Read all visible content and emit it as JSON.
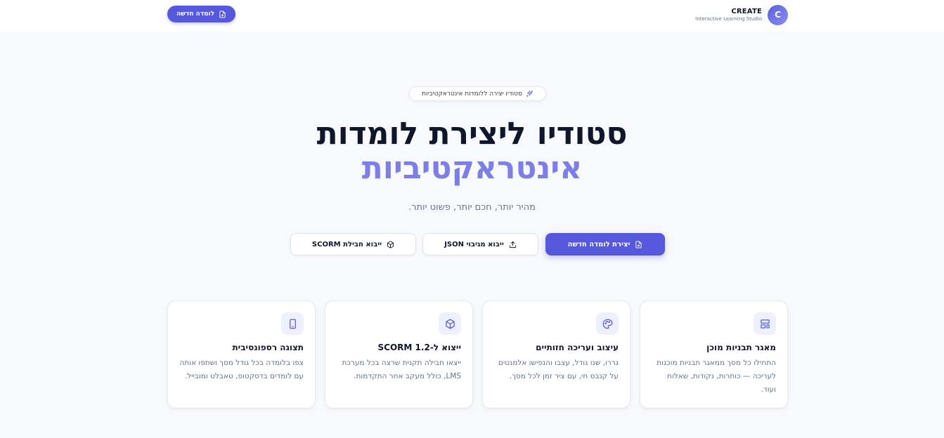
{
  "header": {
    "brand_name": "CREATE",
    "brand_subtitle": "Interactive Learning Studio",
    "brand_logo_letter": "C",
    "new_button_label": "לומדה חדשה"
  },
  "hero": {
    "badge": "סטודיו יצירה ללומדות אינטראקטיביות",
    "title_line1": "סטודיו ליצירת לומדות",
    "title_line2": "אינטראקטיביות",
    "subtitle": "מהיר יותר, חכם יותר, פשוט יותר."
  },
  "actions": {
    "create_new": "יצירת לומדה חדשה",
    "import_json": "ייבוא מגיבוי JSON",
    "import_scorm": "ייבוא חבילת SCORM"
  },
  "features": [
    {
      "icon": "layout-template-icon",
      "title": "מאגר תבניות מוכן",
      "description": "התחילו כל מסך ממאגר תבניות מוכנות לעריכה — כותרות, נקודות, שאלות ועוד."
    },
    {
      "icon": "palette-icon",
      "title": "עיצוב ועריכה חזותיים",
      "description": "גררו, שנו גודל, עצבו והנפישו אלמנטים על קנבס חי, עם ציר זמן לכל מסך."
    },
    {
      "icon": "package-icon",
      "title": "ייצוא ל-SCORM 1.2",
      "description": "ייצאו חבילה תקנית שרצה בכל מערכת LMS, כולל מעקב אחר התקדמות."
    },
    {
      "icon": "smartphone-icon",
      "title": "תצוגה רספונסיבית",
      "description": "צפו בלומדה בכל גודל מסך ושתפו אותה עם לומדים בדסקטופ, טאבלט ומובייל."
    }
  ],
  "colors": {
    "accent": "#5558dd",
    "accent_light": "#7c80e6",
    "background": "#f8f9fc"
  }
}
